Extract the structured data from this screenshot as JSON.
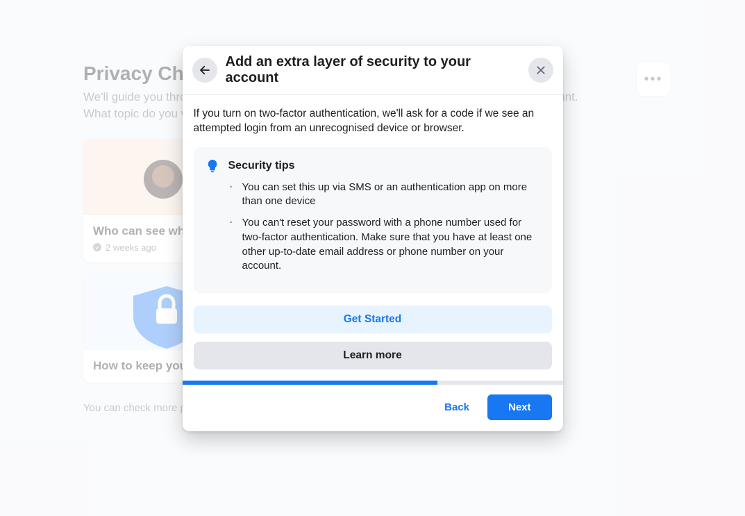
{
  "background": {
    "title": "Privacy Checkup",
    "subtitle": "We'll guide you through some settings so that you can make the right choices for your account. What topic do you want to start with?",
    "cards": [
      {
        "title": "Who can see what you share",
        "meta": "2 weeks ago"
      },
      {
        "title": "How to keep your account secure",
        "meta": ""
      }
    ],
    "footer": "You can check more privacy settings on Facebook in Settings.",
    "kebab_icon": "more-icon"
  },
  "modal": {
    "title": "Add an extra layer of security to your account",
    "intro": "If you turn on two-factor authentication, we'll ask for a code if we see an attempted login from an unrecognised device or browser.",
    "tips_title": "Security tips",
    "tips": [
      "You can set this up via SMS or an authentication app on more than one device",
      "You can't reset your password with a phone number used for two-factor authentication. Make sure that you have at least one other up-to-date email address or phone number on your account."
    ],
    "get_started": "Get Started",
    "learn_more": "Learn more",
    "back": "Back",
    "next": "Next",
    "progress_pct": 67
  }
}
